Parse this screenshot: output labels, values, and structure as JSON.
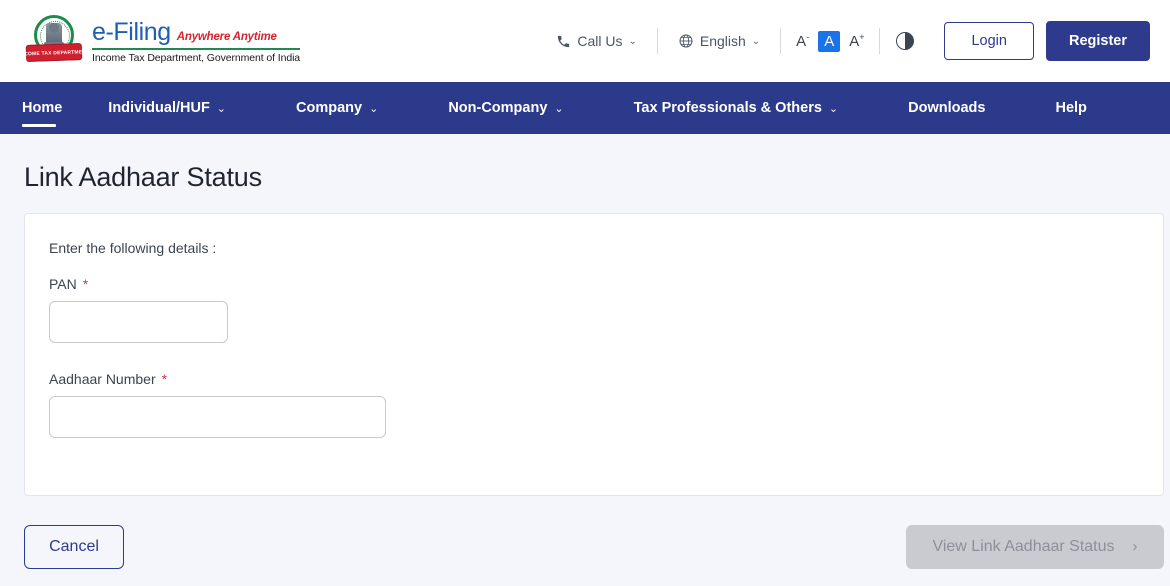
{
  "header": {
    "logo": {
      "emblem_alt": "income-tax-department-emblem",
      "ribbon_text": "INCOME TAX DEPARTMENT",
      "title": "e-Filing",
      "tagline": "Anywhere Anytime",
      "subtitle": "Income Tax Department, Government of India"
    },
    "tools": {
      "call_us": "Call Us",
      "language": "English",
      "font_decrease": "A",
      "font_decrease_sup": "-",
      "font_normal": "A",
      "font_increase": "A",
      "font_increase_sup": "+",
      "contrast": "contrast-toggle",
      "chevron": "⌄"
    },
    "login_label": "Login",
    "register_label": "Register"
  },
  "nav": {
    "items": [
      {
        "label": "Home",
        "has_chevron": false,
        "active": true
      },
      {
        "label": "Individual/HUF",
        "has_chevron": true,
        "active": false
      },
      {
        "label": "Company",
        "has_chevron": true,
        "active": false
      },
      {
        "label": "Non-Company",
        "has_chevron": true,
        "active": false
      },
      {
        "label": "Tax Professionals & Others",
        "has_chevron": true,
        "active": false
      },
      {
        "label": "Downloads",
        "has_chevron": false,
        "active": false
      },
      {
        "label": "Help",
        "has_chevron": false,
        "active": false
      }
    ],
    "chevron": "⌄"
  },
  "page": {
    "title": "Link Aadhaar Status",
    "card": {
      "note": "Enter the following details :",
      "fields": [
        {
          "label": "PAN",
          "required_mark": "*",
          "value": "",
          "placeholder": ""
        },
        {
          "label": "Aadhaar Number",
          "required_mark": "*",
          "value": "",
          "placeholder": ""
        }
      ]
    },
    "actions": {
      "cancel_label": "Cancel",
      "submit_label": "View Link Aadhaar Status",
      "submit_chevron": "›",
      "submit_disabled": true
    }
  },
  "colors": {
    "nav_blue": "#2c3a8c",
    "brand_blue": "#1d5fb0",
    "brand_red": "#d6242f",
    "brand_green": "#1f8a4c",
    "accent_blue": "#1a73e8",
    "required_red": "#d0364f",
    "page_bg": "#f4f6fb",
    "disabled_bg": "#c9cbd1"
  }
}
